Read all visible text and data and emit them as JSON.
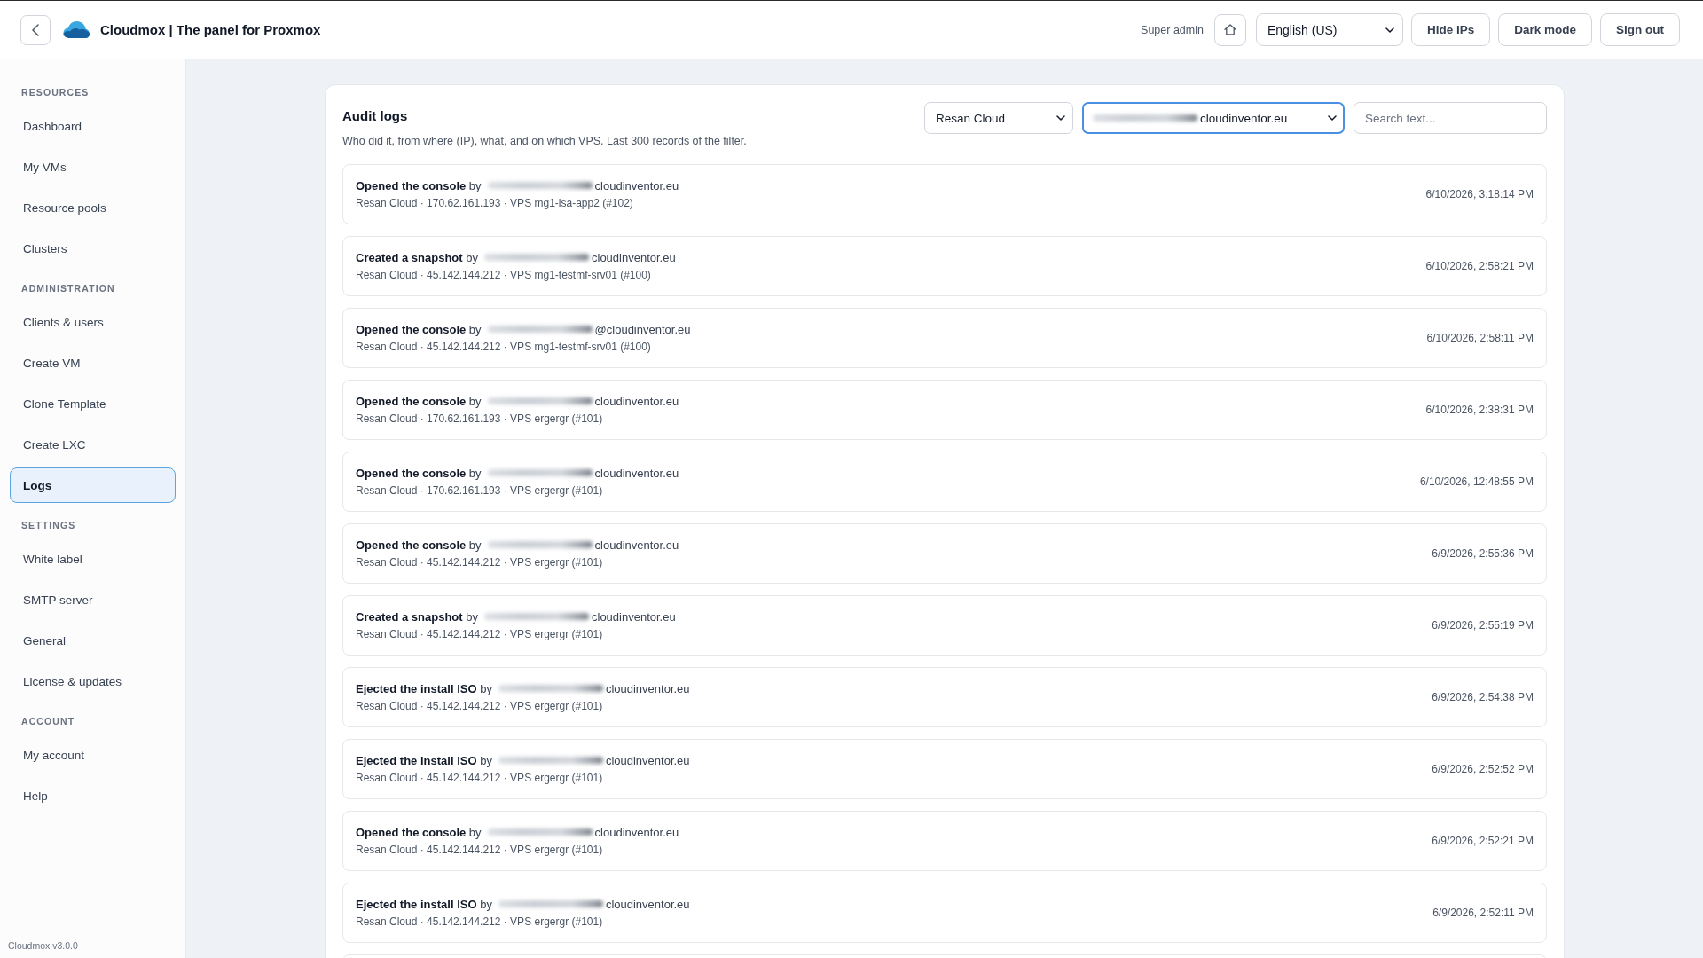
{
  "header": {
    "title": "Cloudmox | The panel for Proxmox",
    "role": "Super admin",
    "language": "English (US)",
    "buttons": [
      "Hide IPs",
      "Dark mode",
      "Sign out"
    ]
  },
  "sidebar": {
    "sections": [
      {
        "heading": "RESOURCES",
        "items": [
          {
            "label": "Dashboard",
            "selected": false
          },
          {
            "label": "My VMs",
            "selected": false
          },
          {
            "label": "Resource pools",
            "selected": false
          },
          {
            "label": "Clusters",
            "selected": false
          }
        ]
      },
      {
        "heading": "ADMINISTRATION",
        "items": [
          {
            "label": "Clients & users",
            "selected": false
          },
          {
            "label": "Create VM",
            "selected": false
          },
          {
            "label": "Clone Template",
            "selected": false
          },
          {
            "label": "Create LXC",
            "selected": false
          },
          {
            "label": "Logs",
            "selected": true
          }
        ]
      },
      {
        "heading": "SETTINGS",
        "items": [
          {
            "label": "White label",
            "selected": false
          },
          {
            "label": "SMTP server",
            "selected": false
          },
          {
            "label": "General",
            "selected": false
          },
          {
            "label": "License & updates",
            "selected": false
          }
        ]
      },
      {
        "heading": "ACCOUNT",
        "items": [
          {
            "label": "My account",
            "selected": false
          },
          {
            "label": "Help",
            "selected": false
          }
        ]
      }
    ],
    "version": "Cloudmox v3.0.0"
  },
  "audit_logs": {
    "title": "Audit logs",
    "description": "Who did it, from where (IP), what, and on which VPS. Last 300 records of the filter.",
    "filters": {
      "cluster": "Resan Cloud",
      "user": {
        "redacted": true,
        "visible_text": "cloudinventor.eu",
        "focused": true
      },
      "search": {
        "placeholder": "Search text..."
      }
    },
    "entries": [
      {
        "summary": "**Opened the console** by",
        "user": {
          "redacted": true,
          "visible_text": "cloudinventor.eu"
        },
        "details": "Resan Cloud · 170.62.161.193 · VPS mg1-lsa-app2 (#102)",
        "time": "6/10/2026, 3:18:14 PM"
      },
      {
        "summary": "**Created a snapshot** by",
        "user": {
          "redacted": true,
          "visible_text": "cloudinventor.eu"
        },
        "details": "Resan Cloud · 45.142.144.212 · VPS mg1-testmf-srv01 (#100)",
        "time": "6/10/2026, 2:58:21 PM"
      },
      {
        "summary": "**Opened the console** by",
        "user": {
          "redacted": true,
          "visible_text": "@cloudinventor.eu"
        },
        "details": "Resan Cloud · 45.142.144.212 · VPS mg1-testmf-srv01 (#100)",
        "time": "6/10/2026, 2:58:11 PM"
      },
      {
        "summary": "**Opened the console** by",
        "user": {
          "redacted": true,
          "visible_text": "cloudinventor.eu"
        },
        "details": "Resan Cloud · 170.62.161.193 · VPS ergergr (#101)",
        "time": "6/10/2026, 2:38:31 PM"
      },
      {
        "summary": "**Opened the console** by",
        "user": {
          "redacted": true,
          "visible_text": "cloudinventor.eu"
        },
        "details": "Resan Cloud · 170.62.161.193 · VPS ergergr (#101)",
        "time": "6/10/2026, 12:48:55 PM"
      },
      {
        "summary": "**Opened the console** by",
        "user": {
          "redacted": true,
          "visible_text": "cloudinventor.eu"
        },
        "details": "Resan Cloud · 45.142.144.212 · VPS ergergr (#101)",
        "time": "6/9/2026, 2:55:36 PM"
      },
      {
        "summary": "**Created a snapshot** by",
        "user": {
          "redacted": true,
          "visible_text": "cloudinventor.eu"
        },
        "details": "Resan Cloud · 45.142.144.212 · VPS ergergr (#101)",
        "time": "6/9/2026, 2:55:19 PM"
      },
      {
        "summary": "**Ejected the install ISO** by",
        "user": {
          "redacted": true,
          "visible_text": "cloudinventor.eu"
        },
        "details": "Resan Cloud · 45.142.144.212 · VPS ergergr (#101)",
        "time": "6/9/2026, 2:54:38 PM"
      },
      {
        "summary": "**Ejected the install ISO** by",
        "user": {
          "redacted": true,
          "visible_text": "cloudinventor.eu"
        },
        "details": "Resan Cloud · 45.142.144.212 · VPS ergergr (#101)",
        "time": "6/9/2026, 2:52:52 PM"
      },
      {
        "summary": "**Opened the console** by",
        "user": {
          "redacted": true,
          "visible_text": "cloudinventor.eu"
        },
        "details": "Resan Cloud · 45.142.144.212 · VPS ergergr (#101)",
        "time": "6/9/2026, 2:52:21 PM"
      },
      {
        "summary": "**Ejected the install ISO** by",
        "user": {
          "redacted": true,
          "visible_text": "cloudinventor.eu"
        },
        "details": "Resan Cloud · 45.142.144.212 · VPS ergergr (#101)",
        "time": "6/9/2026, 2:52:11 PM"
      }
    ]
  }
}
